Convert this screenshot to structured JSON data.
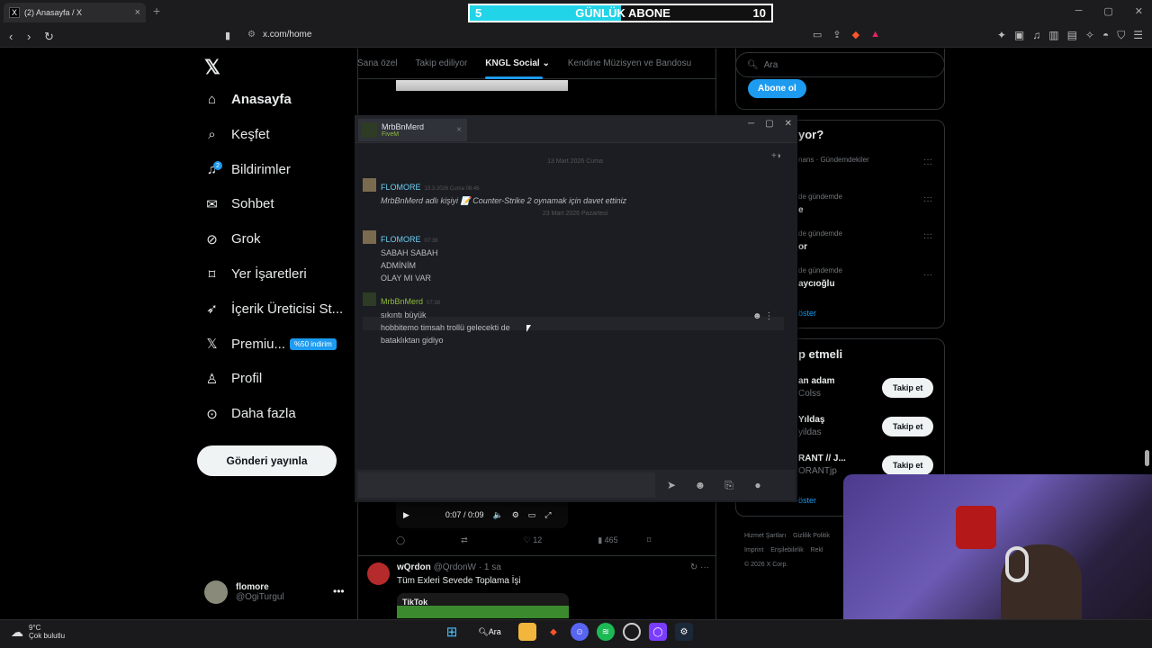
{
  "browser": {
    "tab_title": "(2) Anasayfa / X",
    "url": "x.com/home",
    "tab_favicon": "X"
  },
  "overlay": {
    "abone_current": "5",
    "abone_label": "GÜNLÜK ABONE",
    "abone_target": "10",
    "abone_progress": 0.5
  },
  "sidebar": {
    "items": [
      {
        "label": "Anasayfa",
        "icon": "home-icon"
      },
      {
        "label": "Keşfet",
        "icon": "search-icon"
      },
      {
        "label": "Bildirimler",
        "icon": "bell-icon"
      },
      {
        "label": "Sohbet",
        "icon": "mail-icon"
      },
      {
        "label": "Grok",
        "icon": "grok-icon"
      },
      {
        "label": "Yer İşaretleri",
        "icon": "bookmark-icon"
      },
      {
        "label": "İçerik Üreticisi St...",
        "icon": "rocket-icon"
      },
      {
        "label": "Premiu...",
        "icon": "x-icon"
      },
      {
        "label": "Profil",
        "icon": "person-icon"
      },
      {
        "label": "Daha fazla",
        "icon": "more-circle-icon"
      }
    ],
    "notif_count": "2",
    "premium_badge": "%50 indirim",
    "post_button": "Gönderi yayınla",
    "profile": {
      "name": "flomore",
      "handle": "@OgiTurgul"
    }
  },
  "feed": {
    "tabs": [
      "Sana özel",
      "Takip ediliyor",
      "KNGL Social",
      "Kendine Müzisyen ve Bandosu"
    ],
    "video": {
      "time": "0:07 / 0:09"
    },
    "actions": {
      "likes": "12",
      "views": "465"
    },
    "tweet2": {
      "name": "wQrdon",
      "handle": "@QrdonW",
      "time": "1 sa",
      "text": "Tüm Exleri Sevede Toplama İşi",
      "media_label": "TikTok"
    }
  },
  "right": {
    "search_placeholder": "Ara",
    "abone_ol": "Abone ol",
    "trends_title": "yor?",
    "trend_meta": "nans · Gündemdekiler",
    "trends": [
      {
        "meta": "de gündemde",
        "name": "e"
      },
      {
        "meta": "de gündemde",
        "name": "or"
      },
      {
        "meta": "de gündemde",
        "name": "aycıoğlu"
      }
    ],
    "show_more": "öster",
    "who_title": "p etmeli",
    "who": [
      {
        "name": "an adam",
        "handle": "Colss",
        "btn": "Takip et"
      },
      {
        "name": "Yıldaş",
        "handle": "yildas",
        "btn": "Takip et"
      },
      {
        "name": "RANT // J...",
        "handle": "ORANTjp",
        "btn": "Takip et"
      }
    ],
    "show_more2": "öster",
    "footer": [
      "Hizmet Şartları",
      "Gizlilik Politik",
      "Imprint",
      "Erişilebilirlik",
      "Rekl",
      "© 2026 X Corp."
    ]
  },
  "chat": {
    "tab_name": "MrbBnMerd",
    "tab_game": "FiveM",
    "date1": "13 Mart 2026 Cuma",
    "date2": "23 Mart 2026 Pazartesi",
    "messages": [
      {
        "name": "FLOMORE",
        "time": "13.3.2026 Cuma 08:46",
        "lines": [
          "MrbBnMerd adlı kişiyi 📝 Counter-Strike 2 oynamak için davet ettiniz"
        ]
      },
      {
        "name": "FLOMORE",
        "time": "07:36",
        "lines": [
          "SABAH SABAH",
          "ADMİNİM",
          "OLAY MI VAR"
        ]
      },
      {
        "name": "MrbBnMerd",
        "time": "07:38",
        "lines": [
          "sıkıntı büyük",
          "hobbitemo timsah trollü gelecekti de",
          "bataklıktan gidiyo"
        ]
      }
    ]
  },
  "taskbar": {
    "temp": "9°C",
    "weather": "Çok bulutlu",
    "search": "Ara"
  }
}
